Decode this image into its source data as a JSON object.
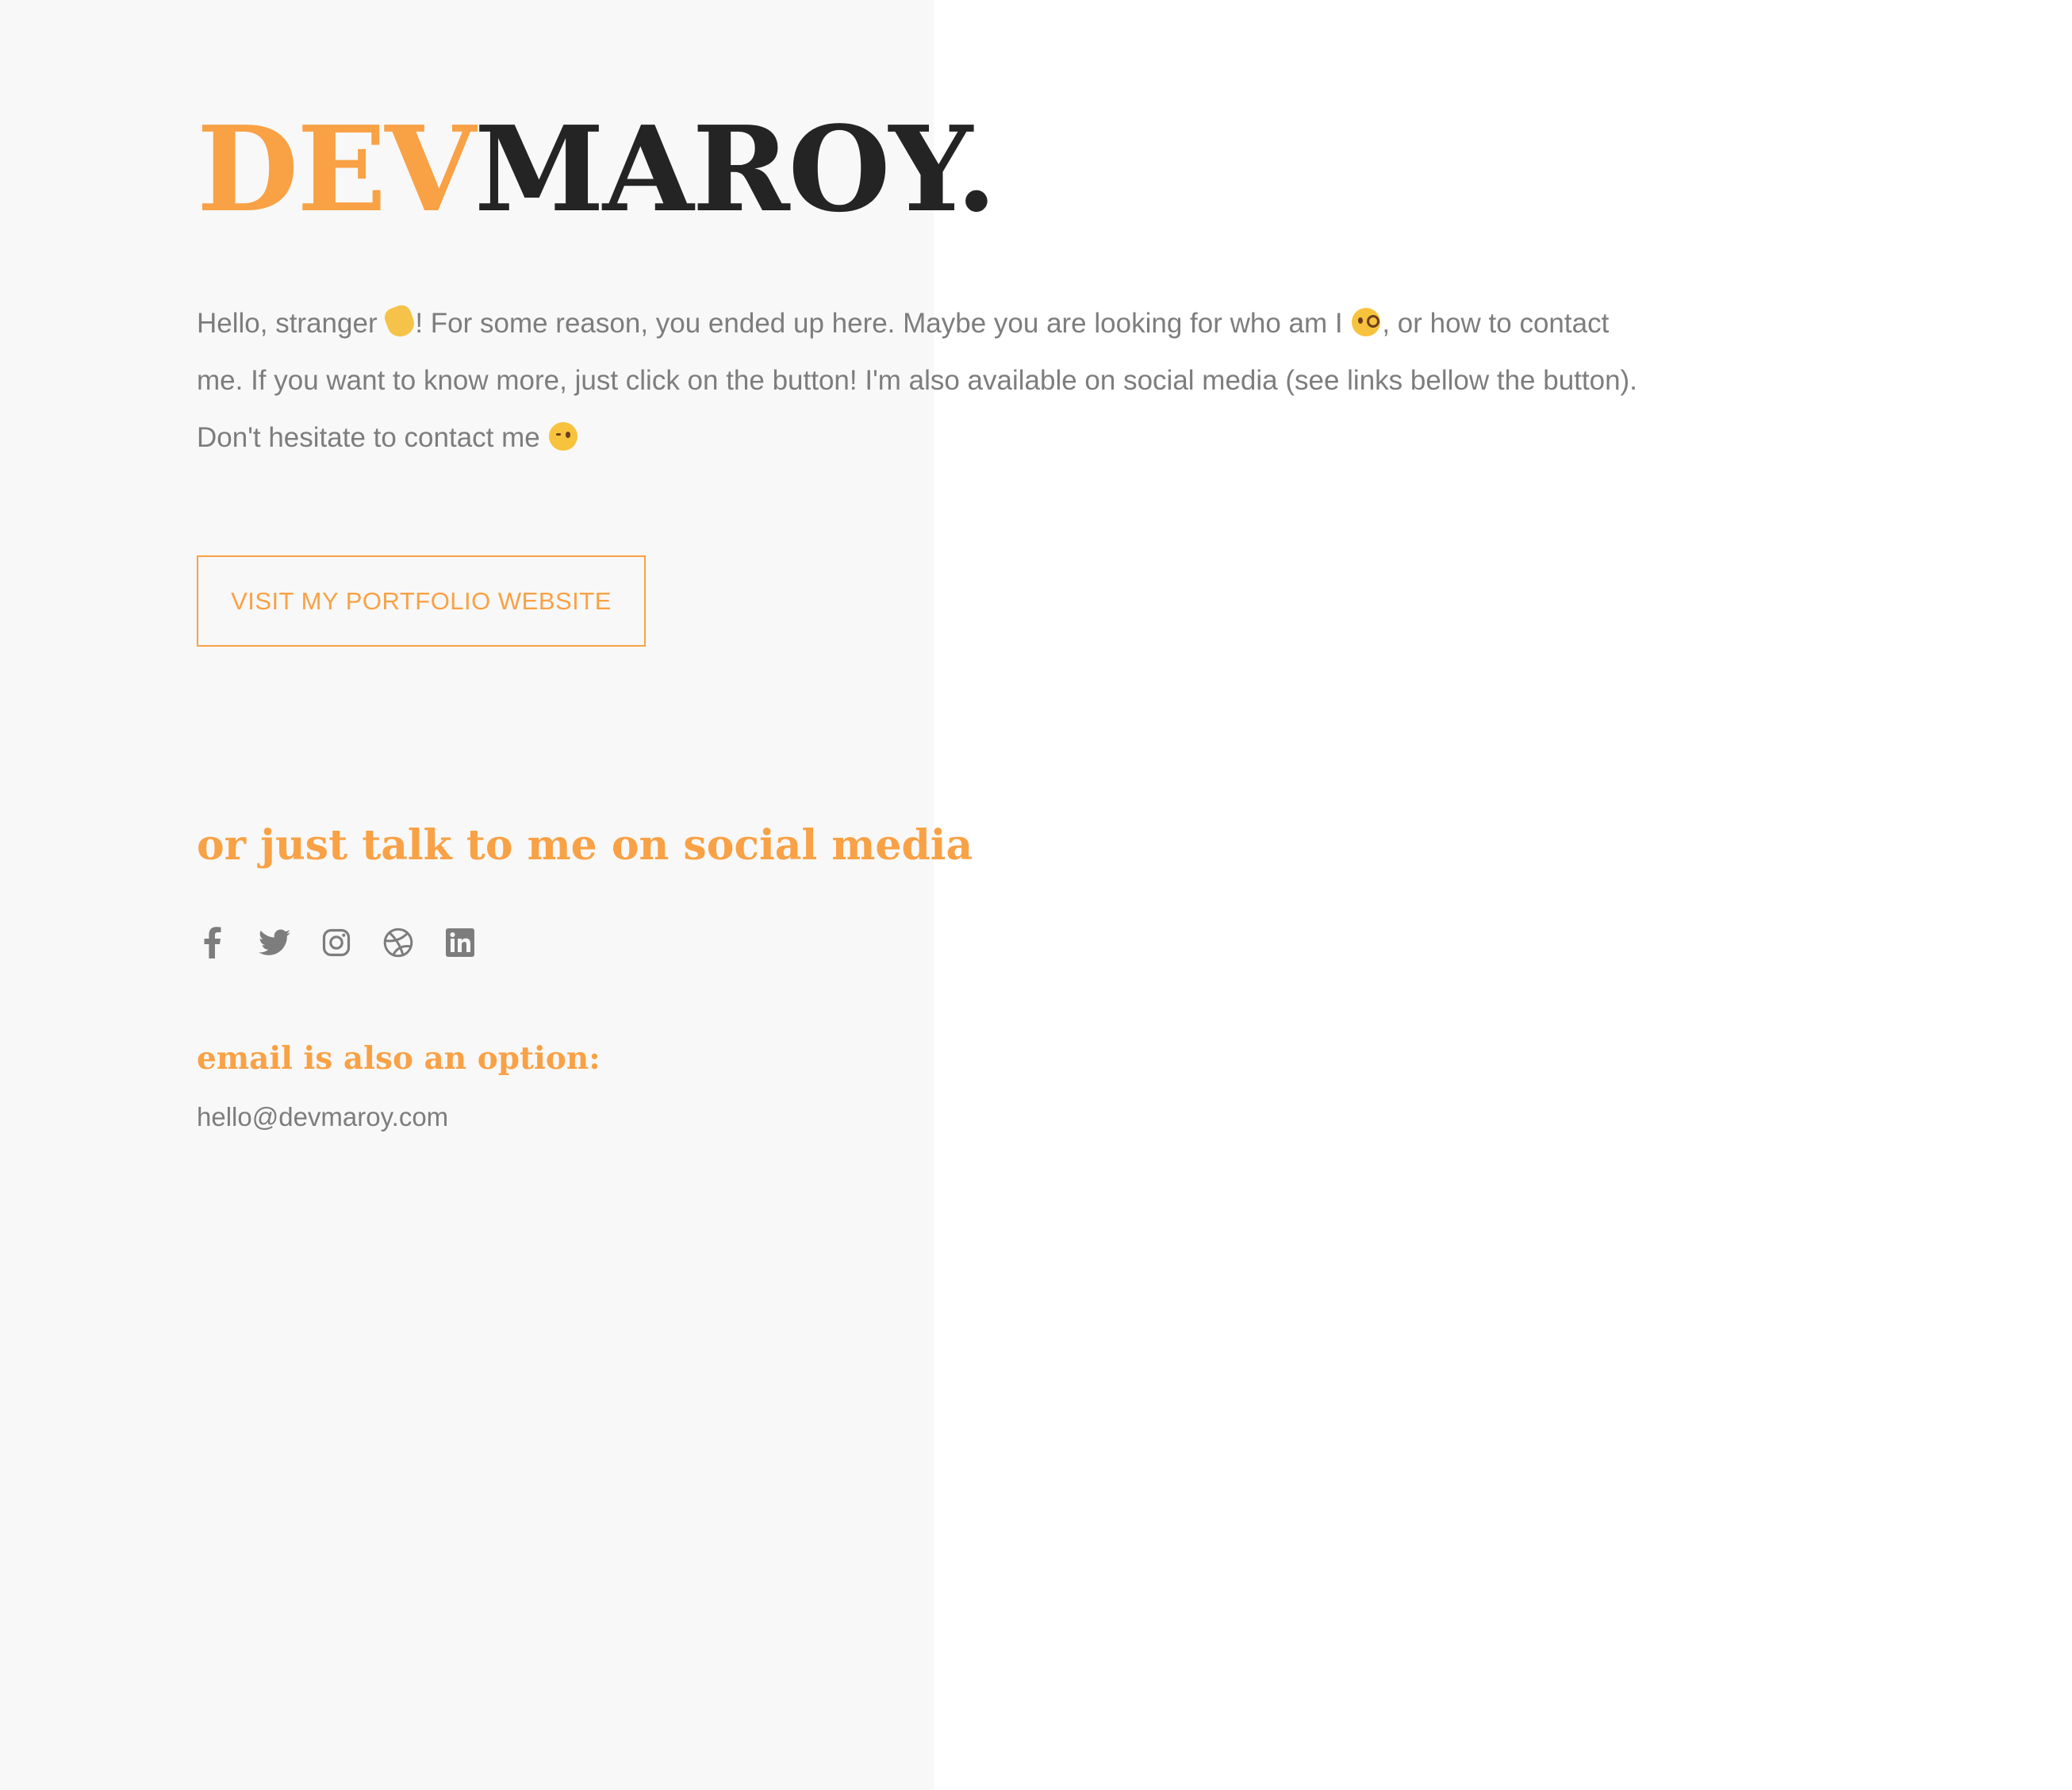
{
  "logo": {
    "accent": "DEV",
    "main": "MAROY."
  },
  "intro": {
    "part1": "Hello, stranger ",
    "part2": "! For some reason, you ended up here. Maybe you are looking for who am I ",
    "part3": ", or how to contact me. If you want to know more, just click on the button! I'm also available on social media (see links bellow the button). Don't hesitate to contact me ",
    "emoji_1": "waving-hand-emoji",
    "emoji_2": "face-with-monocle-emoji",
    "emoji_3": "winking-face-emoji"
  },
  "cta": {
    "label": "VISIT MY PORTFOLIO WEBSITE"
  },
  "social": {
    "heading": "or just talk to me on social media",
    "icons": [
      "facebook-icon",
      "twitter-icon",
      "instagram-icon",
      "dribbble-icon",
      "linkedin-icon"
    ]
  },
  "email": {
    "heading": "email is also an option:",
    "address": "hello@devmaroy.com"
  },
  "colors": {
    "accent": "#f9a145",
    "logo_dark": "#242424",
    "body_text": "#7d7d7d",
    "icon_gray": "#7d7d7d",
    "left_panel_bg": "#f8f8f8",
    "page_bg": "#ffffff"
  }
}
